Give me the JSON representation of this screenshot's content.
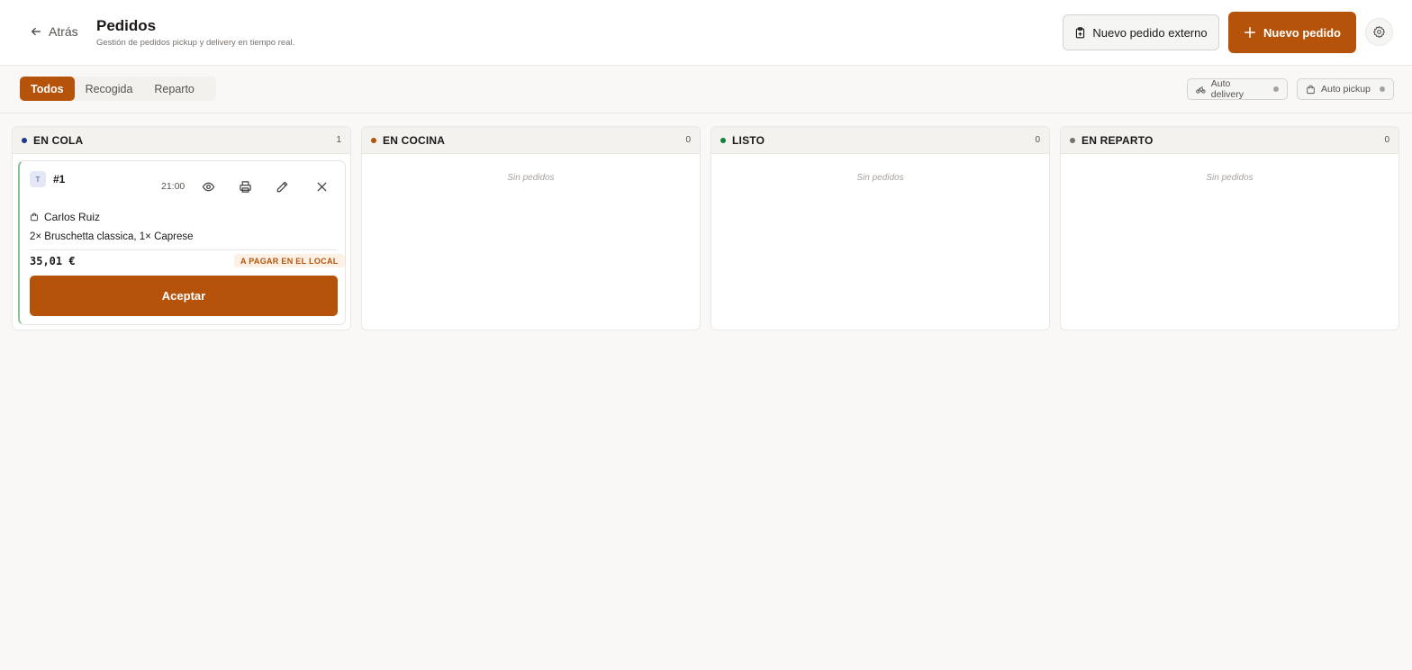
{
  "header": {
    "back_label": "Atrás",
    "title": "Pedidos",
    "subtitle": "Gestión de pedidos pickup y delivery en tiempo real.",
    "external_order_label": "Nuevo pedido externo",
    "new_order_label": "Nuevo pedido"
  },
  "filters": {
    "tabs": [
      {
        "label": "Todos",
        "active": true
      },
      {
        "label": "Recogida",
        "active": false
      },
      {
        "label": "Reparto",
        "active": false
      }
    ],
    "auto_delivery_label": "Auto delivery",
    "auto_pickup_label": "Auto pickup"
  },
  "columns": [
    {
      "title": "EN COLA",
      "count": "1",
      "color": "#1e3a8a"
    },
    {
      "title": "EN COCINA",
      "count": "0",
      "color": "#b5530a",
      "empty_text": "Sin pedidos"
    },
    {
      "title": "LISTO",
      "count": "0",
      "color": "#15803d",
      "empty_text": "Sin pedidos"
    },
    {
      "title": "EN REPARTO",
      "count": "0",
      "color": "#78716c",
      "empty_text": "Sin pedidos"
    }
  ],
  "order": {
    "avatar": "T",
    "number": "#1",
    "time": "21:00",
    "customer": "Carlos Ruiz",
    "items": "2× Bruschetta classica, 1× Caprese",
    "total": "35,01 €",
    "payment_badge": "A PAGAR EN EL LOCAL",
    "accept_label": "Aceptar"
  },
  "colors": {
    "accent": "#b5530a",
    "background": "#f9f8f6"
  }
}
